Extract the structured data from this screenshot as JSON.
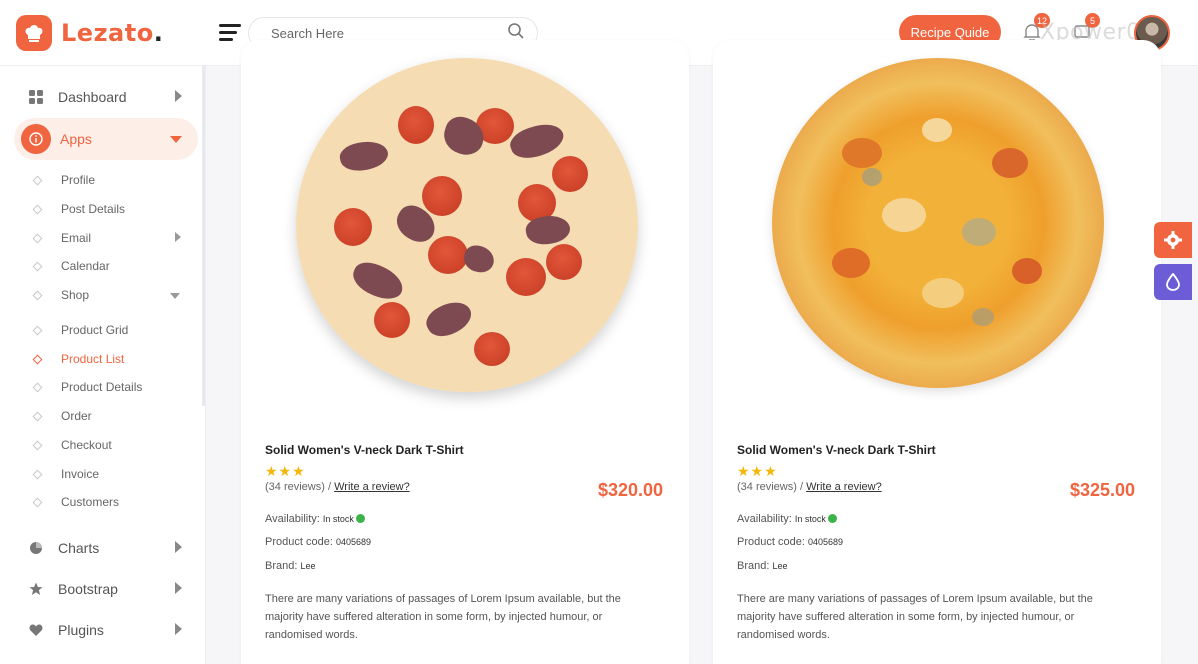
{
  "header": {
    "brand_name": "Lezato",
    "brand_dot": ".",
    "search_placeholder": "Search Here",
    "recipe_button": "Recipe Quide",
    "notifications_count": "12",
    "messages_count": "5",
    "watermark": "Xpower08"
  },
  "sidebar": {
    "main_items": [
      {
        "label": "Dashboard",
        "icon": "grid-icon"
      },
      {
        "label": "Apps",
        "icon": "info-icon"
      },
      {
        "label": "Charts",
        "icon": "chart-icon"
      },
      {
        "label": "Bootstrap",
        "icon": "star-icon"
      },
      {
        "label": "Plugins",
        "icon": "heart-icon"
      }
    ],
    "sub_items": [
      "Profile",
      "Post Details",
      "Email",
      "Calendar",
      "Shop",
      "Product Grid",
      "Product List",
      "Product Details",
      "Order",
      "Checkout",
      "Invoice",
      "Customers"
    ],
    "active_sub": "Product List"
  },
  "products": [
    {
      "title": "Solid Women's V-neck Dark T-Shirt",
      "stars": "★★★",
      "reviews": "(34 reviews) /",
      "write_review": "Write a review?",
      "price": "$320.00",
      "availability_label": "Availability:",
      "availability_value": "In stock",
      "code_label": "Product code:",
      "code_value": "0405689",
      "brand_label": "Brand:",
      "brand_value": "Lee",
      "description": "There are many variations of passages of Lorem Ipsum available, but the majority have suffered alteration in some form, by injected humour, or randomised words."
    },
    {
      "title": "Solid Women's V-neck Dark T-Shirt",
      "stars": "★★★",
      "reviews": "(34 reviews) /",
      "write_review": "Write a review?",
      "price": "$325.00",
      "availability_label": "Availability:",
      "availability_value": "In stock",
      "code_label": "Product code:",
      "code_value": "0405689",
      "brand_label": "Brand:",
      "brand_value": "Lee",
      "description": "There are many variations of passages of Lorem Ipsum available, but the majority have suffered alteration in some form, by injected humour, or randomised words."
    }
  ],
  "colors": {
    "accent": "#f0643f",
    "purple": "#6c5cd6",
    "star": "#f5b60a",
    "stock": "#3cb44a"
  }
}
